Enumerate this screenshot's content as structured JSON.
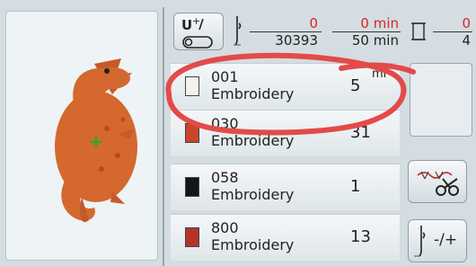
{
  "status": {
    "stitch_current": "0",
    "stitch_total": "30393",
    "time_current": "0 min",
    "time_total": "50 min",
    "color_current": "0",
    "color_total": "4"
  },
  "threads": [
    {
      "code": "001",
      "name": "Embroidery",
      "count": "5",
      "color": "#f2f2f0"
    },
    {
      "code": "030",
      "name": "Embroidery",
      "count": "31",
      "color": "#c9452a"
    },
    {
      "code": "058",
      "name": "Embroidery",
      "count": "1",
      "color": "#151515"
    },
    {
      "code": "800",
      "name": "Embroidery",
      "count": "13",
      "color": "#b5342a"
    }
  ],
  "row1_overflow_text": "mi",
  "buttons": {
    "needle_adjust_label": "-/+"
  },
  "colors": {
    "accent_red": "#d8232a",
    "highlight_circle": "#e34a4a",
    "dragon": "#d4682e"
  },
  "icons": {
    "top_left": "upper-thread-icon",
    "needle": "needle-icon",
    "spool": "spool-icon",
    "cutter": "thread-cutter-icon",
    "needle_adjust": "needle-adjust-icon"
  }
}
